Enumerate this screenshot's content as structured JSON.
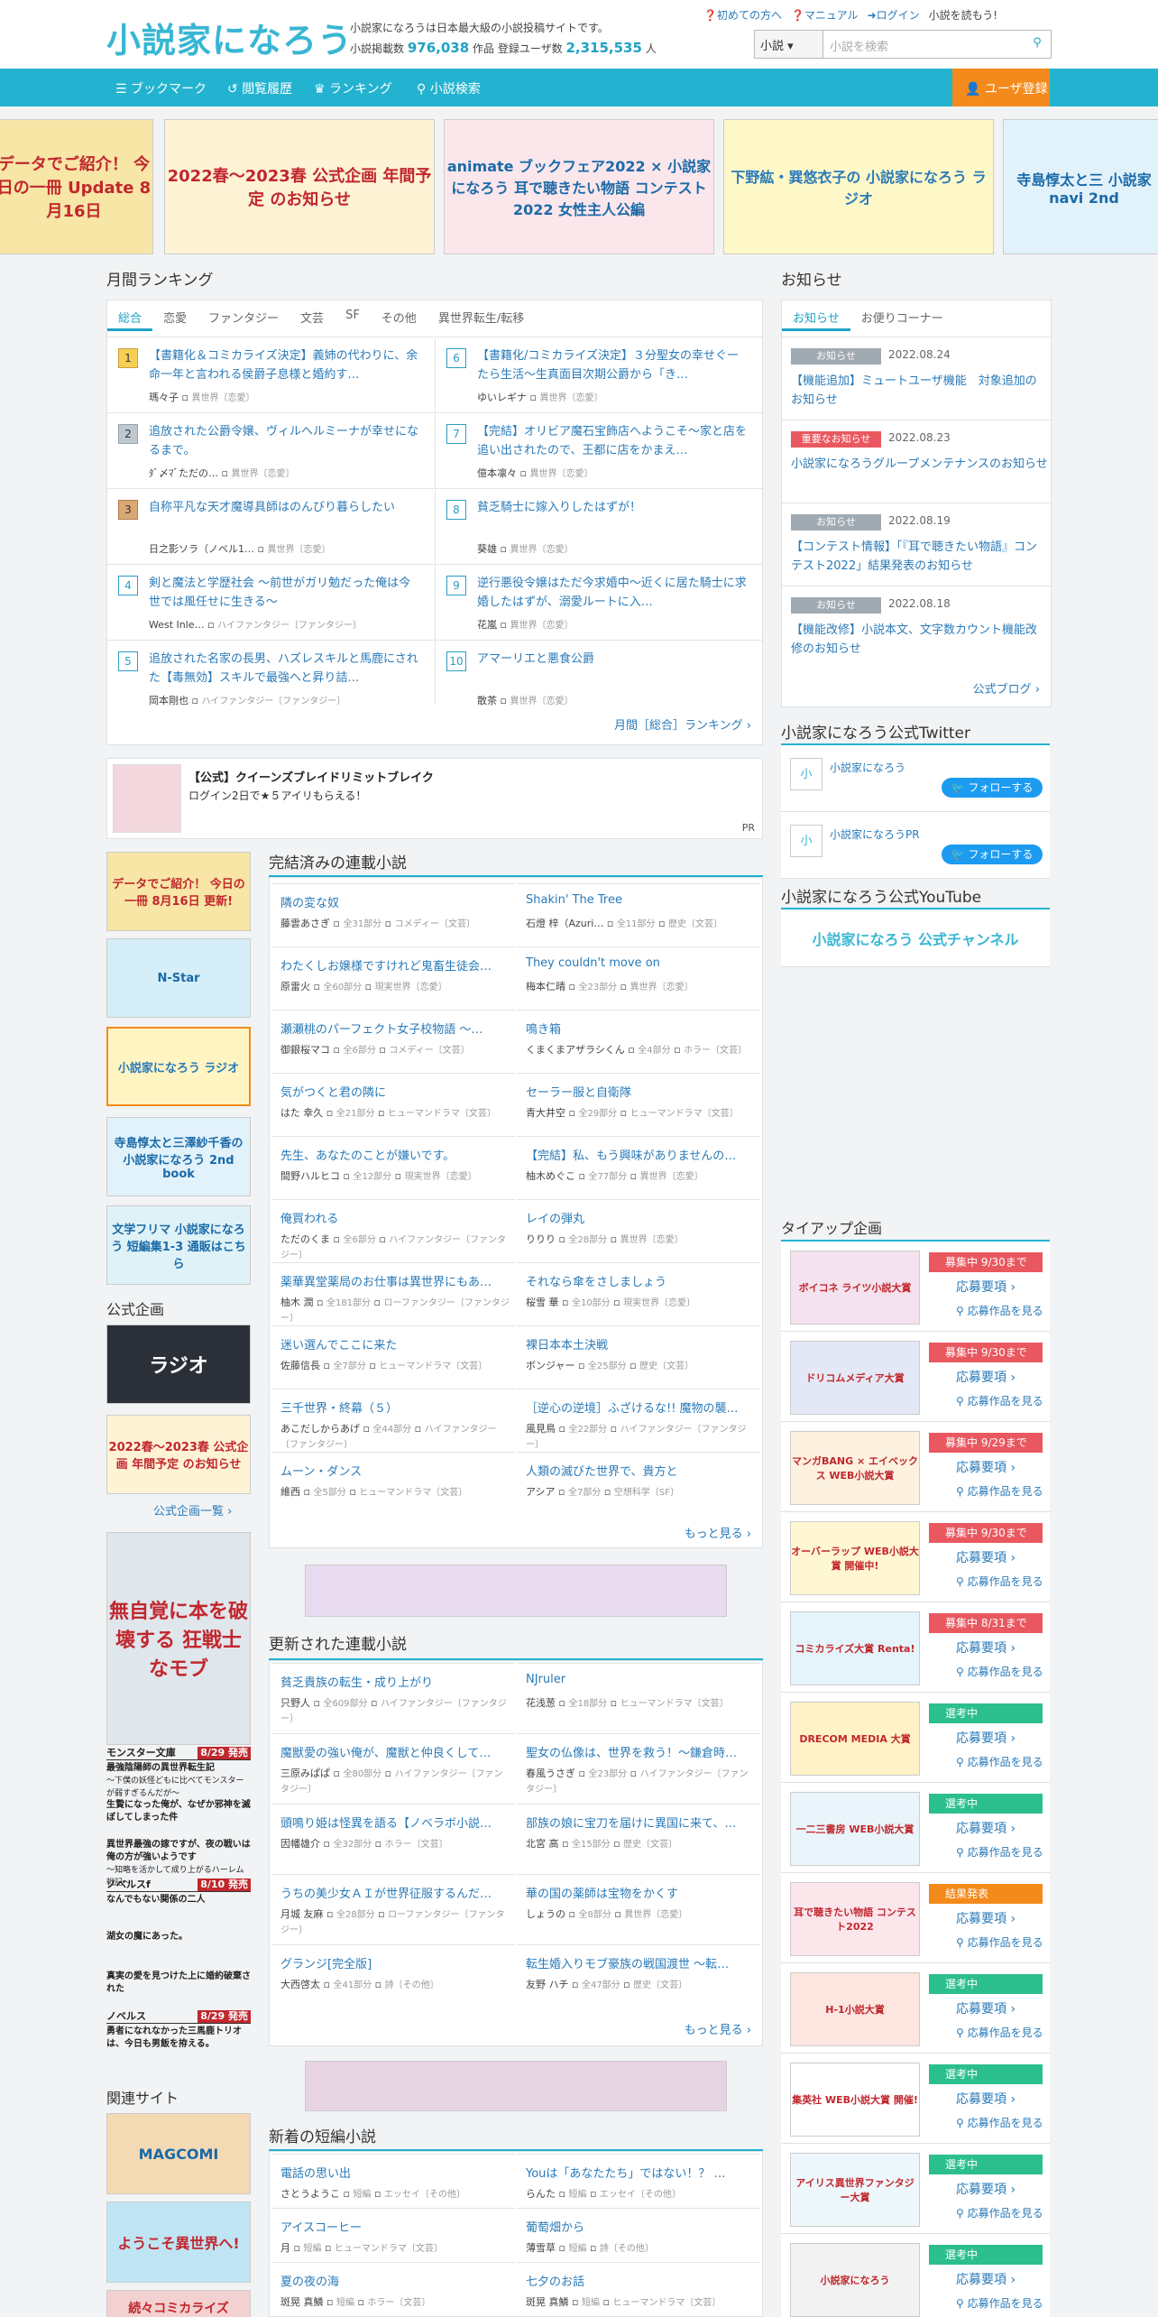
{
  "header": {
    "logo": "小説家になろう",
    "tagline": "小説家になろうは日本最大級の小説投稿サイトです。",
    "stats_novels_label": "小説掲載数",
    "stats_novels": "976,038",
    "stats_novels_unit": "作品",
    "stats_users_label": "登録ユーザ数",
    "stats_users": "2,315,535",
    "stats_users_unit": "人",
    "links": [
      "初めての方へ",
      "マニュアル",
      "ログイン",
      "小説を読もう!"
    ],
    "search_select": "小説",
    "search_placeholder": "小説を検索"
  },
  "nav": {
    "items": [
      "ブックマーク",
      "閲覧履歴",
      "ランキング",
      "小説検索"
    ],
    "register": "ユーザ登録"
  },
  "banners": [
    "データでご紹介！ 今日の一冊 Update 8月16日",
    "2022春〜2023春 公式企画 年間予定 のお知らせ",
    "animate ブックフェア2022 × 小説家になろう 耳で聴きたい物語 コンテスト2022 女性主人公編",
    "下野紘・巽悠衣子の 小説家になろう ラジオ",
    "寺島惇太と三 小説家 navi 2nd"
  ],
  "monthly": {
    "title": "月間ランキング",
    "tabs": [
      "総合",
      "恋愛",
      "ファンタジー",
      "文芸",
      "SF",
      "その他",
      "異世界転生/転移"
    ],
    "items": [
      {
        "rank": "1",
        "title": "【書籍化＆コミカライズ決定】義姉の代わりに、余命一年と言われる侯爵子息様と婚約す…",
        "author": "瑪々子",
        "genre": "異世界〔恋愛〕"
      },
      {
        "rank": "2",
        "title": "追放された公爵令嬢、ヴィルヘルミーナが幸せになるまで。",
        "author": "ﾀﾞ〆ﾏﾞただの…",
        "genre": "異世界〔恋愛〕"
      },
      {
        "rank": "3",
        "title": "自称平凡な天才魔導具師はのんびり暮らしたい",
        "author": "日之影ソラ（ノベル1…",
        "genre": "異世界〔恋愛〕"
      },
      {
        "rank": "4",
        "title": "剣と魔法と学歴社会 〜前世がガリ勉だった俺は今世では風任せに生きる〜",
        "author": "West Inle…",
        "genre": "ハイファンタジー〔ファンタジー〕"
      },
      {
        "rank": "5",
        "title": "追放された名家の長男、ハズレスキルと馬鹿にされた【毒無効】スキルで最強へと昇り詰…",
        "author": "岡本剛也",
        "genre": "ハイファンタジー〔ファンタジー〕"
      },
      {
        "rank": "6",
        "title": "【書籍化/コミカライズ決定】３分聖女の幸せぐーたら生活〜生真面目次期公爵から「き…",
        "author": "ゆいレギナ",
        "genre": "異世界〔恋愛〕"
      },
      {
        "rank": "7",
        "title": "【完結】オリビア魔石宝飾店へようこそ〜家と店を追い出されたので、王都に店をかまえ…",
        "author": "億本凛々",
        "genre": "異世界〔恋愛〕"
      },
      {
        "rank": "8",
        "title": "貧乏騎士に嫁入りしたはずが！",
        "author": "葵雄",
        "genre": "異世界〔恋愛〕"
      },
      {
        "rank": "9",
        "title": "逆行悪役令嬢はただ今求婚中〜近くに居た騎士に求婚したはずが、溺愛ルートに入…",
        "author": "花嵐",
        "genre": "異世界〔恋愛〕"
      },
      {
        "rank": "10",
        "title": "アマーリエと悪食公爵",
        "author": "散茶",
        "genre": "異世界〔恋愛〕"
      }
    ],
    "more": "月間［総合］ランキング"
  },
  "ad": {
    "title": "【公式】クイーンズブレイドリミットブレイク",
    "sub": "ログイン2日で★５アイリもらえる！",
    "pr": "PR"
  },
  "completed": {
    "title": "完結済みの連載小説",
    "items": [
      {
        "title": "隣の変な奴",
        "author": "藤雲あさぎ",
        "meta": "全31部分",
        "genre": "コメディー〔文芸〕"
      },
      {
        "title": "Shakin' The Tree",
        "author": "石燈 梓（Azuri…",
        "meta": "全11部分",
        "genre": "歴史〔文芸〕"
      },
      {
        "title": "わたくしお嬢様ですけれど鬼畜生徒会…",
        "author": "原雷火",
        "meta": "全60部分",
        "genre": "現実世界〔恋愛〕"
      },
      {
        "title": "They couldn't move on",
        "author": "梅本仁晴",
        "meta": "全23部分",
        "genre": "異世界〔恋愛〕"
      },
      {
        "title": "瀬瀬桃のパーフェクト女子校物語 〜…",
        "author": "御銀桜マコ",
        "meta": "全6部分",
        "genre": "コメディー〔文芸〕"
      },
      {
        "title": "鳴き箱",
        "author": "くまくまアザラシくん",
        "meta": "全4部分",
        "genre": "ホラー〔文芸〕"
      },
      {
        "title": "気がつくと君の隣に",
        "author": "はた 幸久",
        "meta": "全21部分",
        "genre": "ヒューマンドラマ〔文芸〕"
      },
      {
        "title": "セーラー服と自衛隊",
        "author": "青大井空",
        "meta": "全29部分",
        "genre": "ヒューマンドラマ〔文芸〕"
      },
      {
        "title": "先生、あなたのことが嫌いです。",
        "author": "間野ハルヒコ",
        "meta": "全12部分",
        "genre": "現実世界〔恋愛〕"
      },
      {
        "title": "【完結】私、もう興味がありませんの…",
        "author": "柚木めぐこ",
        "meta": "全77部分",
        "genre": "異世界〔恋愛〕"
      },
      {
        "title": "俺買われる",
        "author": "ただのくま",
        "meta": "全6部分",
        "genre": "ハイファンタジー〔ファンタジー〕"
      },
      {
        "title": "レイの弾丸",
        "author": "りりり",
        "meta": "全28部分",
        "genre": "異世界〔恋愛〕"
      },
      {
        "title": "薬華異堂薬局のお仕事は異世界にもあ…",
        "author": "柚木 潤",
        "meta": "全181部分",
        "genre": "ローファンタジー〔ファンタジー〕"
      },
      {
        "title": "それなら傘をさしましょう",
        "author": "桜雪 華",
        "meta": "全10部分",
        "genre": "現実世界〔恋愛〕"
      },
      {
        "title": "迷い選んでここに来た",
        "author": "佐藤信長",
        "meta": "全7部分",
        "genre": "ヒューマンドラマ〔文芸〕"
      },
      {
        "title": "裸日本本土決戦",
        "author": "ボンジャー",
        "meta": "全25部分",
        "genre": "歴史〔文芸〕"
      },
      {
        "title": "三千世界・終幕（５）",
        "author": "あこだしからあげ",
        "meta": "全44部分",
        "genre": "ハイファンタジー〔ファンタジー〕"
      },
      {
        "title": "［逆心の逆境］ふざけるな!! 魔物の襲…",
        "author": "風見鳥",
        "meta": "全22部分",
        "genre": "ハイファンタジー〔ファンタジー〕"
      },
      {
        "title": "ムーン・ダンス",
        "author": "維西",
        "meta": "全5部分",
        "genre": "ヒューマンドラマ〔文芸〕"
      },
      {
        "title": "人類の滅びた世界で、貴方と",
        "author": "アシア",
        "meta": "全7部分",
        "genre": "空想科学〔SF〕"
      }
    ],
    "more": "もっと見る"
  },
  "updated": {
    "title": "更新された連載小説",
    "items": [
      {
        "title": "貧乏貴族の転生・成り上がり",
        "author": "只野人",
        "meta": "全609部分",
        "genre": "ハイファンタジー〔ファンタジー〕"
      },
      {
        "title": "NJruler",
        "author": "花浅葱",
        "meta": "全18部分",
        "genre": "ヒューマンドラマ〔文芸〕"
      },
      {
        "title": "魔獣愛の強い俺が、魔獣と仲良くして…",
        "author": "三原みぱぱ",
        "meta": "全80部分",
        "genre": "ハイファンタジー〔ファンタジー〕"
      },
      {
        "title": "聖女の仏像は、世界を救う！〜鎌倉時…",
        "author": "春風うさぎ",
        "meta": "全23部分",
        "genre": "ハイファンタジー〔ファンタジー〕"
      },
      {
        "title": "頭鳴り姫は怪異を語る【ノベラボ小説…",
        "author": "因幡雄介",
        "meta": "全32部分",
        "genre": "ホラー〔文芸〕"
      },
      {
        "title": "部族の娘に宝刀を届けに異国に来て、…",
        "author": "北宮 高",
        "meta": "全15部分",
        "genre": "歴史〔文芸〕"
      },
      {
        "title": "うちの美少女ＡＩが世界征服するんだ…",
        "author": "月城 友麻",
        "meta": "全28部分",
        "genre": "ローファンタジー〔ファンタジー〕"
      },
      {
        "title": "華の国の薬師は宝物をかくす",
        "author": "しょうの",
        "meta": "全8部分",
        "genre": "異世界〔恋愛〕"
      },
      {
        "title": "グランジ[完全版]",
        "author": "大西啓太",
        "meta": "全41部分",
        "genre": "詩〔その他〕"
      },
      {
        "title": "転生婚入りモブ豪族の戦国渡世 〜転…",
        "author": "友野 ハチ",
        "meta": "全47部分",
        "genre": "歴史〔文芸〕"
      }
    ],
    "more": "もっと見る"
  },
  "short": {
    "title": "新着の短編小説",
    "items": [
      {
        "title": "電話の思い出",
        "author": "さとうようこ",
        "meta": "短編",
        "genre": "エッセイ〔その他〕"
      },
      {
        "title": "Youは「あなたたち」ではない！？ …",
        "author": "らんた",
        "meta": "短編",
        "genre": "エッセイ〔その他〕"
      },
      {
        "title": "アイスコーヒー",
        "author": "月",
        "meta": "短編",
        "genre": "ヒューマンドラマ〔文芸〕"
      },
      {
        "title": "葡萄畑から",
        "author": "薄雪草",
        "meta": "短編",
        "genre": "詩〔その他〕"
      },
      {
        "title": "夏の夜の海",
        "author": "斑晃 真鱗",
        "meta": "短編",
        "genre": "ホラー〔文芸〕"
      },
      {
        "title": "七夕のお話",
        "author": "斑晃 真鱗",
        "meta": "短編",
        "genre": "ヒューマンドラマ〔文芸〕"
      }
    ]
  },
  "left_col": {
    "banners": [
      "データでご紹介！ 今日の一冊 8月16日 更新!",
      "N-Star",
      "小説家になろう ラジオ",
      "寺島惇太と三澤紗千香の 小説家になろう 2nd book",
      "文学フリマ 小説家になろう 短編集1-3 通販はこちら"
    ],
    "official_title": "公式企画",
    "official_banners": [
      "ラジオ",
      "2022春〜2023春 公式企画 年間予定 のお知らせ"
    ],
    "official_more": "公式企画一覧",
    "book_ad_title": "無自覚に本を破壊する 狂戦士なモブ",
    "book_list": [
      {
        "label": "モンスター文庫",
        "date": "8/29 発売",
        "title": "最強陰陽師の異世界転生記",
        "desc": "〜下僕の妖怪どもに比べてモンスターが弱すぎるんだが〜"
      },
      {
        "label": "",
        "date": "",
        "title": "生贄になった俺が、なぜか邪神を滅ぼしてしまった件",
        "desc": ""
      },
      {
        "label": "",
        "date": "",
        "title": "異世界最強の嫁ですが、夜の戦いは俺の方が強いようです",
        "desc": "〜知略を活かして成り上がるハーレム戦記〜"
      },
      {
        "label": "ノベルスf",
        "date": "8/10 発売",
        "title": "なんでもない関係の二人",
        "desc": ""
      },
      {
        "label": "",
        "date": "",
        "title": "湖女の魔にあった。",
        "desc": ""
      },
      {
        "label": "",
        "date": "",
        "title": "真実の愛を見つけた上に婚約破棄された",
        "desc": ""
      },
      {
        "label": "ノベルス",
        "date": "8/29 発売",
        "title": "勇者になれなかった三馬鹿トリオは、今日も男飯を拵える。",
        "desc": ""
      }
    ],
    "related_title": "関連サイト",
    "related": [
      "MAGCOMI",
      "ようこそ異世界へ!",
      "続々コミカライズ"
    ]
  },
  "news": {
    "title": "お知らせ",
    "tabs": [
      "お知らせ",
      "お便りコーナー"
    ],
    "items": [
      {
        "tag": "お知らせ",
        "date": "2022.08.24",
        "title": "【機能追加】ミュートユーザ機能　対象追加のお知らせ",
        "red": false
      },
      {
        "tag": "重要なお知らせ",
        "date": "2022.08.23",
        "title": "小説家になろうグループメンテナンスのお知らせ",
        "red": true
      },
      {
        "tag": "お知らせ",
        "date": "2022.08.19",
        "title": "【コンテスト情報】「『耳で聴きたい物語』コンテスト2022」結果発表のお知らせ",
        "red": false
      },
      {
        "tag": "お知らせ",
        "date": "2022.08.18",
        "title": "【機能改修】小説本文、文字数カウント機能改修のお知らせ",
        "red": false
      }
    ],
    "blog": "公式ブログ"
  },
  "twitter": {
    "title": "小説家になろう公式Twitter",
    "accounts": [
      "小説家になろう",
      "小説家になろうPR"
    ],
    "follow": "フォローする"
  },
  "youtube": {
    "title": "小説家になろう公式YouTube",
    "banner": "小説家になろう 公式チャンネル"
  },
  "tieup": {
    "title": "タイアップ企画",
    "link1": "応募要項",
    "link2": "応募作品を見る",
    "items": [
      {
        "img": "ボイコネ ライツ小説大賞",
        "status": "募集中 9/30まで",
        "color": "#e9585f"
      },
      {
        "img": "ドリコムメディア大賞",
        "status": "募集中 9/30まで",
        "color": "#e9585f"
      },
      {
        "img": "マンガBANG × エイベックス WEB小説大賞",
        "status": "募集中 9/29まで",
        "color": "#e9585f"
      },
      {
        "img": "オーバーラップ WEB小説大賞 開催中!",
        "status": "募集中 9/30まで",
        "color": "#e9585f"
      },
      {
        "img": "コミカライズ大賞 Renta!",
        "status": "募集中 8/31まで",
        "color": "#e9585f"
      },
      {
        "img": "DRECOM MEDIA 大賞",
        "status": "選考中",
        "color": "#2cbf8e"
      },
      {
        "img": "一二三書房 WEB小説大賞",
        "status": "選考中",
        "color": "#2cbf8e"
      },
      {
        "img": "耳で聴きたい物語 コンテスト2022",
        "status": "結果発表",
        "color": "#f38a1b"
      },
      {
        "img": "H-1小説大賞",
        "status": "選考中",
        "color": "#2cbf8e"
      },
      {
        "img": "集英社 WEB小説大賞 開催!",
        "status": "選考中",
        "color": "#2cbf8e"
      },
      {
        "img": "アイリス異世界ファンタジー大賞",
        "status": "選考中",
        "color": "#2cbf8e"
      },
      {
        "img": "小説家になろう",
        "status": "選考中",
        "color": "#2cbf8e"
      }
    ]
  }
}
